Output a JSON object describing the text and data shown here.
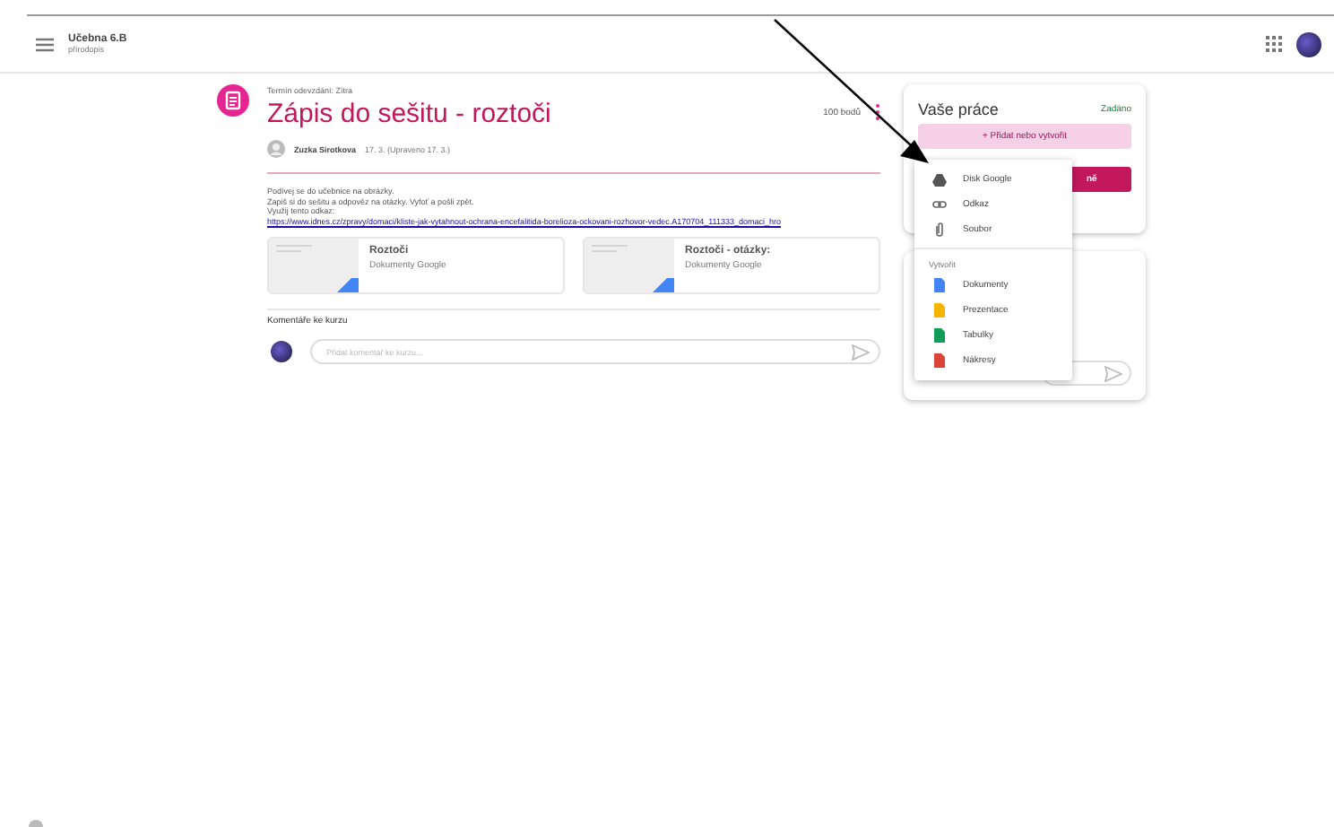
{
  "header": {
    "title": "Učebna 6.B",
    "subtitle": "přírodopis"
  },
  "assignment": {
    "due": "Termín odevzdání: Zítra",
    "title": "Zápis do sešitu - roztoči",
    "points": "100 bodů",
    "author": "Zuzka Sirotkova",
    "date": "17. 3. (Upraveno 17. 3.)",
    "lines": [
      "Podívej se do učebnice na obrázky.",
      "Zapiš si do sešitu a odpověz na otázky. Vyfoť a pošli zpět."
    ],
    "link_label": "Využij tento odkaz:",
    "link": "https://www.idnes.cz/zpravy/domaci/kliste-jak-vytahnout-ochrana-encefalitida-borelioza-ockovani-rozhovor-vedec.A170704_111333_domaci_hro",
    "attachments": [
      {
        "name": "Roztoči",
        "type": "Dokumenty Google"
      },
      {
        "name": "Roztoči - otázky:",
        "type": "Dokumenty Google"
      }
    ]
  },
  "comments": {
    "title": "Komentáře ke kurzu",
    "placeholder": "Přidat komentář ke kurzu..."
  },
  "work": {
    "title": "Vaše práce",
    "status": "Zadáno",
    "add_button": "+ Přidat nebo vytvořit",
    "done_button": "ně"
  },
  "menu": {
    "items": [
      {
        "kind": "drive",
        "label": "Disk Google"
      },
      {
        "kind": "link",
        "label": "Odkaz"
      },
      {
        "kind": "file",
        "label": "Soubor"
      }
    ],
    "create_title": "Vytvořit",
    "create": [
      {
        "label": "Dokumenty",
        "color": "#4285f4"
      },
      {
        "label": "Prezentace",
        "color": "#f4b400"
      },
      {
        "label": "Tabulky",
        "color": "#0f9d58"
      },
      {
        "label": "Nákresy",
        "color": "#db4437"
      }
    ]
  }
}
